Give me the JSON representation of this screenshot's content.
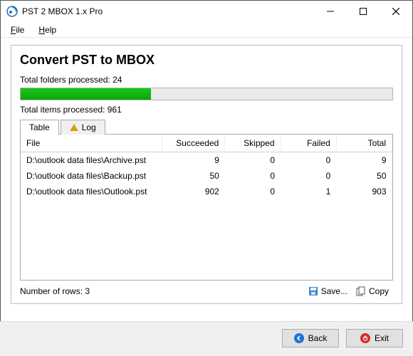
{
  "window": {
    "title": "PST 2 MBOX 1.x Pro"
  },
  "menu": {
    "file": "File",
    "help": "Help"
  },
  "main": {
    "heading": "Convert PST to MBOX",
    "folders_label": "Total folders processed: 24",
    "progress_percent": 35,
    "items_label": "Total items processed: 961"
  },
  "tabs": {
    "table": "Table",
    "log": "Log"
  },
  "table": {
    "columns": {
      "file": "File",
      "succeeded": "Succeeded",
      "skipped": "Skipped",
      "failed": "Failed",
      "total": "Total"
    },
    "rows": [
      {
        "file": "D:\\outlook data files\\Archive.pst",
        "succeeded": 9,
        "skipped": 0,
        "failed": 0,
        "total": 9
      },
      {
        "file": "D:\\outlook data files\\Backup.pst",
        "succeeded": 50,
        "skipped": 0,
        "failed": 0,
        "total": 50
      },
      {
        "file": "D:\\outlook data files\\Outlook.pst",
        "succeeded": 902,
        "skipped": 0,
        "failed": 1,
        "total": 903
      }
    ],
    "row_count_label": "Number of rows: 3"
  },
  "actions": {
    "save": "Save...",
    "copy": "Copy",
    "back": "Back",
    "exit": "Exit"
  }
}
